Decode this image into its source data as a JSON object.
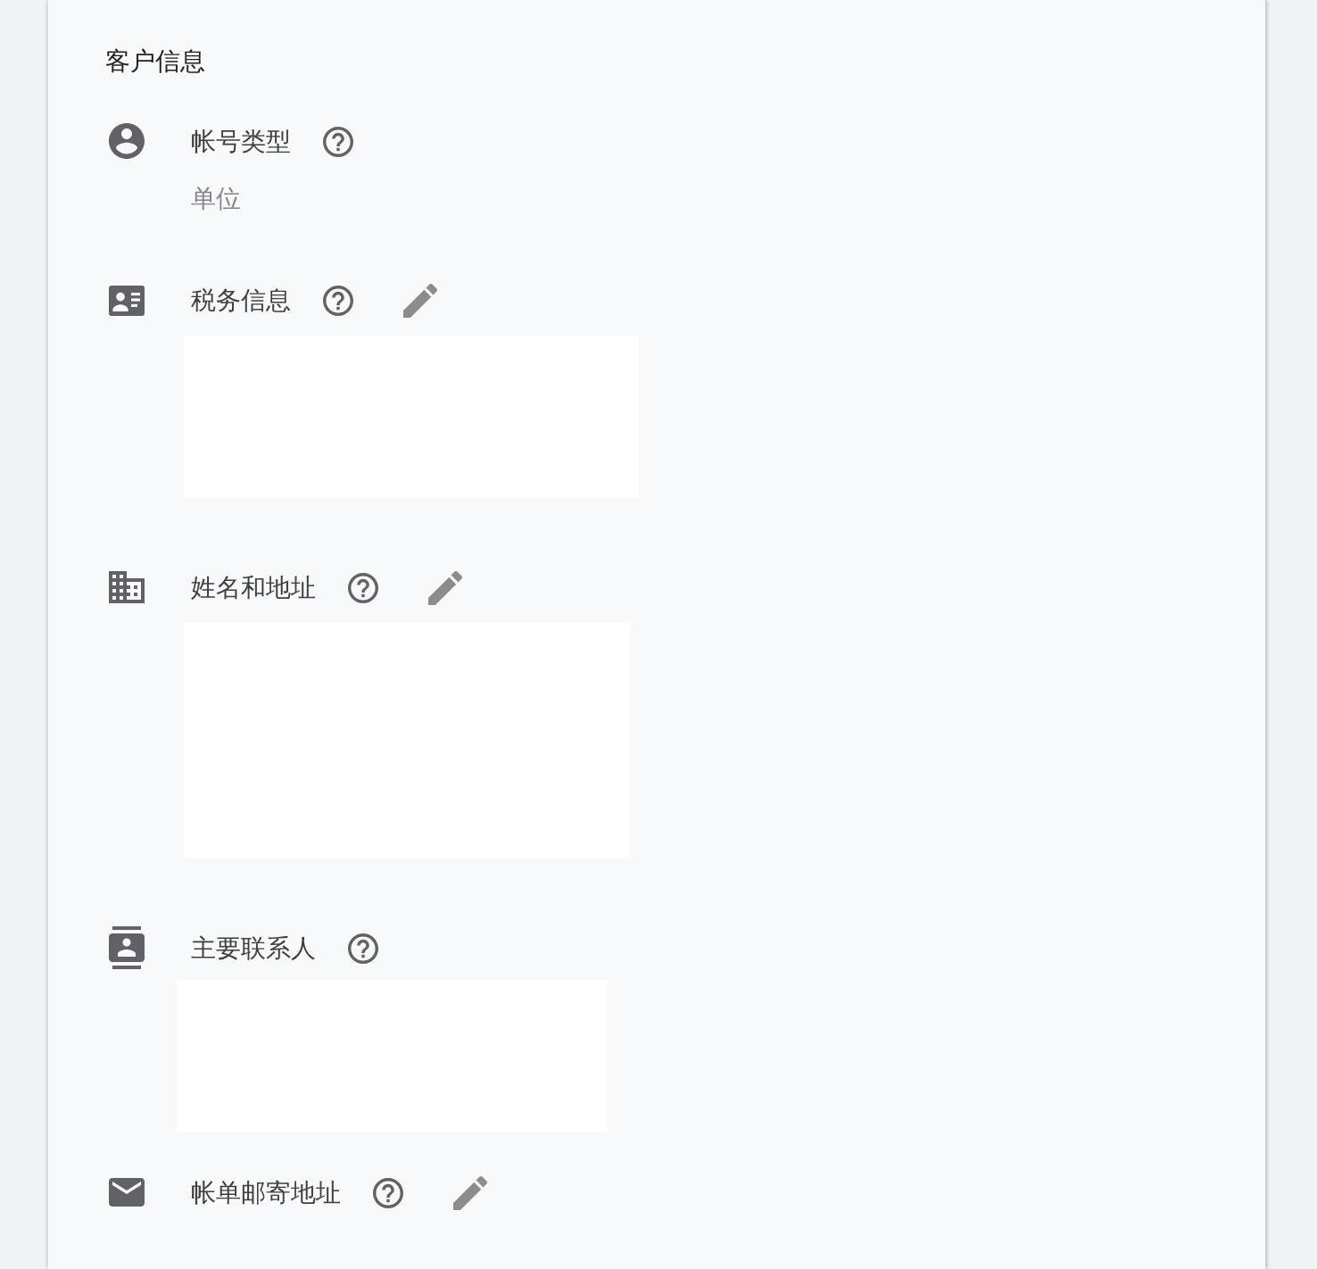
{
  "section": {
    "title": "客户信息"
  },
  "fields": [
    {
      "label": "帐号类型",
      "editable": false,
      "detail": {
        "kind": "text",
        "value": "单位"
      }
    },
    {
      "label": "税务信息",
      "editable": true,
      "detail": {
        "kind": "blank"
      }
    },
    {
      "label": "姓名和地址",
      "editable": true,
      "detail": {
        "kind": "blank"
      }
    },
    {
      "label": "主要联系人",
      "editable": false,
      "detail": {
        "kind": "blank"
      }
    },
    {
      "label": "帐单邮寄地址",
      "editable": true
    }
  ]
}
